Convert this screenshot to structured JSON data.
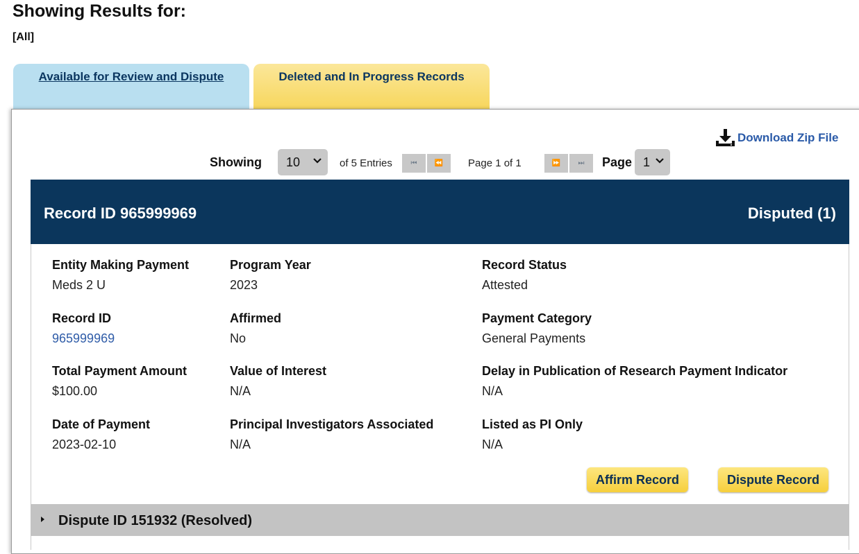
{
  "page": {
    "heading": "Showing Results for:",
    "filter": "[All]"
  },
  "tabs": [
    {
      "label": "Available for Review and Dispute"
    },
    {
      "label": "Deleted and In Progress Records"
    }
  ],
  "toolbar": {
    "download_label": "Download Zip File",
    "download_icon": "download-tray-icon"
  },
  "pager": {
    "showing_label": "Showing",
    "entries_per_page": "10",
    "entries_text": "of 5 Entries",
    "first_icon": "first-page-icon",
    "prev_icon": "prev-page-icon",
    "page_text": "Page 1 of 1",
    "next_icon": "next-page-icon",
    "last_icon": "last-page-icon",
    "page_label": "Page",
    "page_value": "1"
  },
  "record": {
    "header_id": "Record ID 965999969",
    "status_badge": "Disputed (1)",
    "fields": [
      {
        "label": "Entity Making Payment",
        "value": "Meds 2 U"
      },
      {
        "label": "Program Year",
        "value": "2023"
      },
      {
        "label": "Record Status",
        "value": "Attested"
      },
      {
        "label": "Record ID",
        "value": "965999969"
      },
      {
        "label": "Affirmed",
        "value": "No"
      },
      {
        "label": "Payment Category",
        "value": "General Payments"
      },
      {
        "label": "Total Payment Amount",
        "value": "$100.00"
      },
      {
        "label": "Value of Interest",
        "value": "N/A"
      },
      {
        "label": "Delay in Publication of Research Payment Indicator",
        "value": "N/A"
      },
      {
        "label": "Date of Payment",
        "value": "2023-02-10"
      },
      {
        "label": "Principal Investigators Associated",
        "value": "N/A"
      },
      {
        "label": "Listed as PI Only",
        "value": "N/A"
      }
    ],
    "affirm_label": "Affirm Record",
    "dispute_label": "Dispute Record"
  },
  "dispute": {
    "label": "Dispute ID 151932 (Resolved)"
  },
  "colors": {
    "header_bg": "#0b365c",
    "tab_review_bg": "#b9dff0",
    "tab_deleted_bg": "#f7d65c",
    "button_bg": "#f6cf3c",
    "link": "#2f5ca8"
  }
}
